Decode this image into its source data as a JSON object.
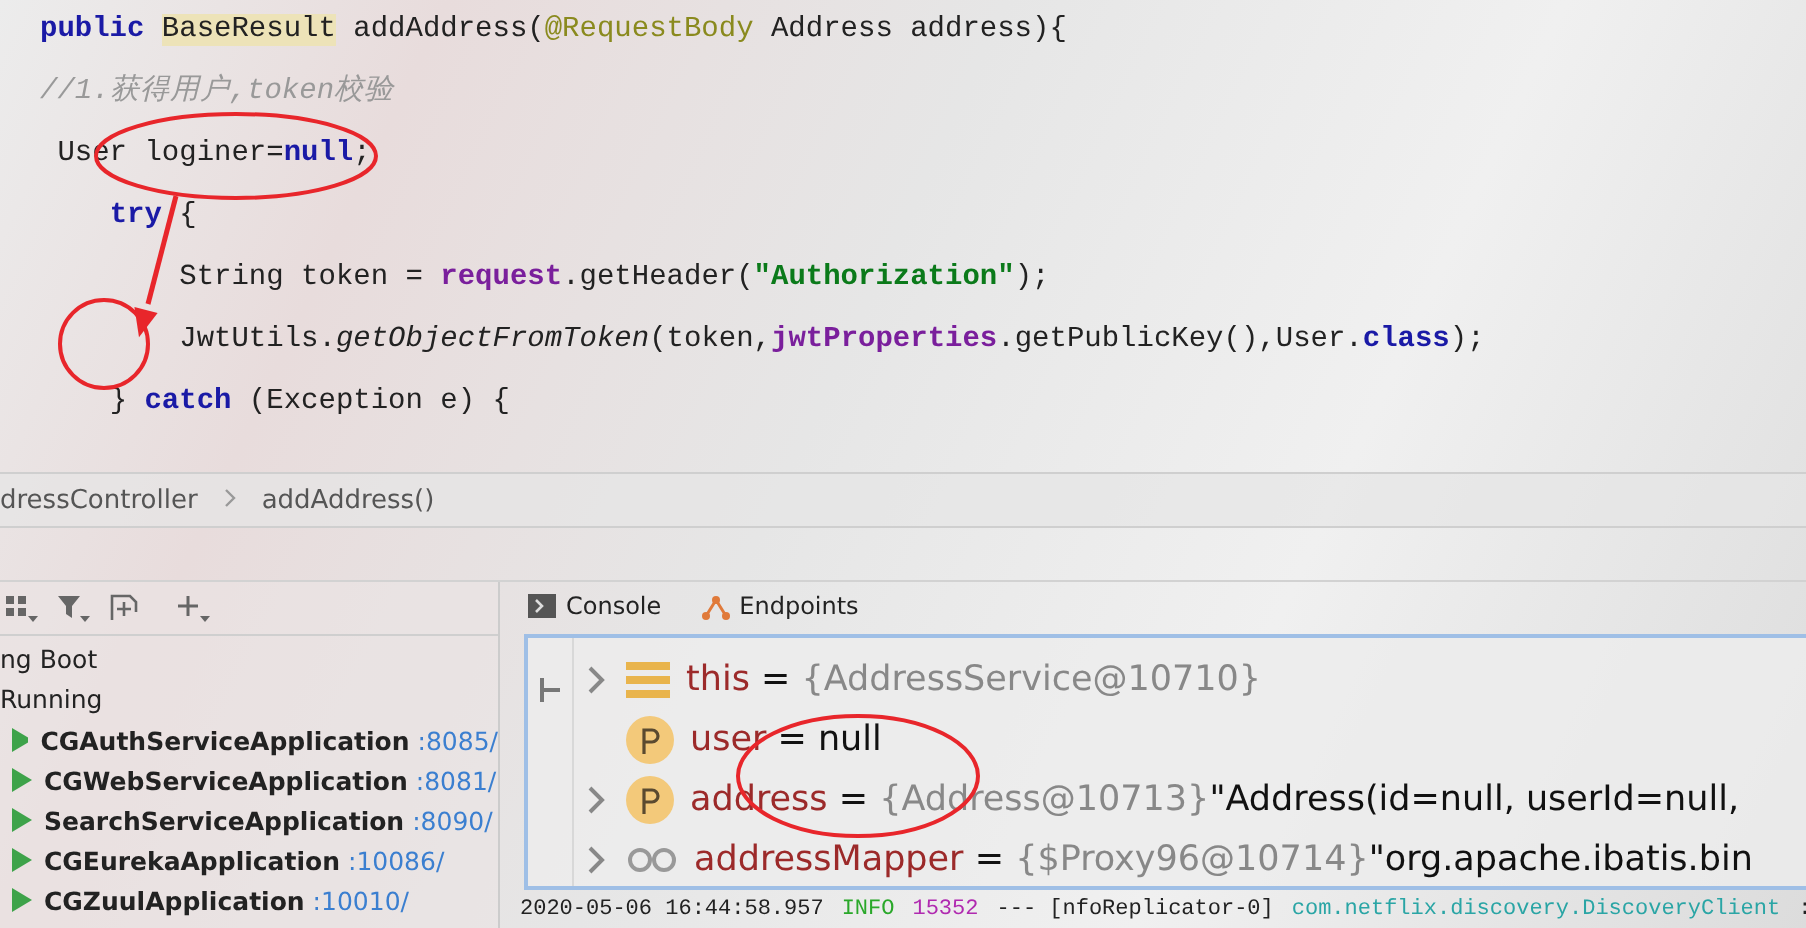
{
  "editor": {
    "lines": [
      [
        {
          "kind": "keyword",
          "text": "public "
        },
        {
          "kind": "type-hl",
          "text": "BaseResult"
        },
        {
          "kind": "plain",
          "text": " addAddress("
        },
        {
          "kind": "annotation",
          "text": "@RequestBody"
        },
        {
          "kind": "plain",
          "text": " Address address){"
        }
      ],
      [
        {
          "kind": "comment",
          "text": "//1.获得用户,token校验"
        }
      ],
      [
        {
          "kind": "plain",
          "text": " User loginer="
        },
        {
          "kind": "keyword",
          "text": "null"
        },
        {
          "kind": "plain",
          "text": ";"
        }
      ],
      [
        {
          "kind": "keyword",
          "text": "    try"
        },
        {
          "kind": "plain",
          "text": " {"
        }
      ],
      [
        {
          "kind": "plain",
          "text": "        String token = "
        },
        {
          "kind": "field",
          "text": "request"
        },
        {
          "kind": "plain",
          "text": ".getHeader("
        },
        {
          "kind": "string",
          "text": "\"Authorization\""
        },
        {
          "kind": "plain",
          "text": ");"
        }
      ],
      [
        {
          "kind": "plain",
          "text": "        JwtUtils."
        },
        {
          "kind": "italic",
          "text": "getObjectFromToken"
        },
        {
          "kind": "plain",
          "text": "(token,"
        },
        {
          "kind": "field",
          "text": "jwtProperties"
        },
        {
          "kind": "plain",
          "text": ".getPublicKey(),User."
        },
        {
          "kind": "keyword",
          "text": "class"
        },
        {
          "kind": "plain",
          "text": ");"
        }
      ],
      [
        {
          "kind": "plain",
          "text": "    } "
        },
        {
          "kind": "keyword",
          "text": "catch"
        },
        {
          "kind": "plain",
          "text": " (Exception e) {"
        }
      ]
    ]
  },
  "breadcrumb": [
    "dressController",
    "addAddress()"
  ],
  "services": {
    "tree": [
      {
        "label": "ng Boot",
        "kind": "group",
        "children": [
          {
            "label": "Running",
            "kind": "group",
            "children": [
              {
                "label": "CGAuthServiceApplication",
                "port": ":8085/",
                "kind": "app"
              },
              {
                "label": "CGWebServiceApplication",
                "port": ":8081/",
                "kind": "app"
              },
              {
                "label": "SearchServiceApplication",
                "port": ":8090/",
                "kind": "app"
              },
              {
                "label": "CGEurekaApplication",
                "port": ":10086/",
                "kind": "app"
              },
              {
                "label": "CGZuulApplication",
                "port": ":10010/",
                "kind": "app"
              }
            ]
          }
        ]
      }
    ]
  },
  "tabs": [
    {
      "label": "Console",
      "kind": "console",
      "selected": false
    },
    {
      "label": "Endpoints",
      "kind": "endpoints",
      "selected": false
    }
  ],
  "variables": [
    {
      "kind": "object",
      "expandable": true,
      "name": "this",
      "operator": "=",
      "value": "{AddressService@10710}"
    },
    {
      "kind": "param",
      "expandable": false,
      "name": "user",
      "operator": "=",
      "value": "null"
    },
    {
      "kind": "param",
      "expandable": true,
      "name": "address",
      "operator": "=",
      "value": "{Address@10713}",
      "detail": "\"Address(id=null, userId=null,"
    },
    {
      "kind": "field",
      "expandable": true,
      "name": "addressMapper",
      "operator": "=",
      "value": "{$Proxy96@10714}",
      "detail": "\"org.apache.ibatis.bin"
    }
  ],
  "log": [
    {
      "kind": "time",
      "text": "2020-05-06 16:44:58.957"
    },
    {
      "kind": "level",
      "text": "INFO"
    },
    {
      "kind": "pid",
      "text": "15352"
    },
    {
      "kind": "plain",
      "text": "--- [nfoReplicator-0]"
    },
    {
      "kind": "logger",
      "text": "com.netflix.discovery.DiscoveryClient"
    },
    {
      "kind": "plain",
      "text": ":"
    }
  ]
}
